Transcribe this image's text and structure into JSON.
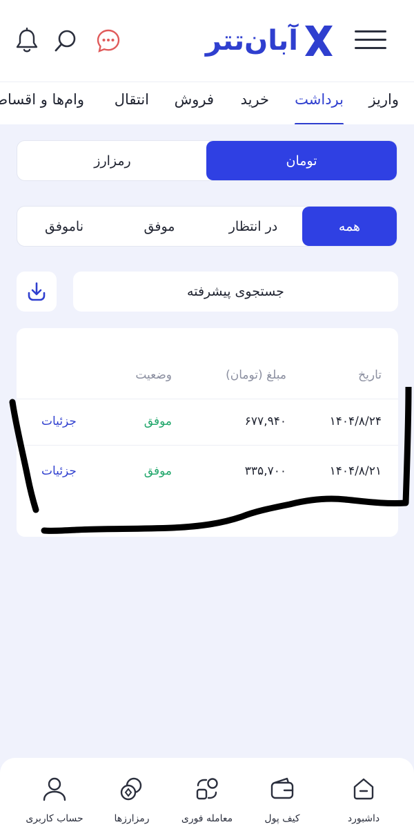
{
  "header": {
    "logo_text": "آبان‌تتر",
    "brand_color": "#2f3fcf",
    "icons": [
      "menu-icon",
      "chat-icon",
      "search-icon",
      "bell-icon"
    ]
  },
  "tabs": [
    {
      "label": "واریز",
      "active": false
    },
    {
      "label": "برداشت",
      "active": true
    },
    {
      "label": "خرید",
      "active": false
    },
    {
      "label": "فروش",
      "active": false
    },
    {
      "label": "انتقال",
      "active": false
    },
    {
      "label": "وام‌ها و اقساط",
      "active": false
    }
  ],
  "currency_filter": {
    "options": [
      "تومان",
      "رمزارز"
    ],
    "selected": "تومان"
  },
  "status_filter": {
    "options": [
      "همه",
      "در انتظار",
      "موفق",
      "ناموفق"
    ],
    "selected": "همه"
  },
  "search": {
    "advanced_label": "جستجوی پیشرفته"
  },
  "table": {
    "headers": {
      "date": "تاریخ",
      "amount": "مبلغ (تومان)",
      "status": "وضعیت"
    },
    "rows": [
      {
        "date": "۱۴۰۴/۸/۲۴",
        "amount": "۶۷۷,۹۴۰",
        "status": "موفق",
        "details": "جزئیات"
      },
      {
        "date": "۱۴۰۴/۸/۲۱",
        "amount": "۳۳۵,۷۰۰",
        "status": "موفق",
        "details": "جزئیات"
      }
    ]
  },
  "bottom_nav": [
    {
      "label": "داشبورد",
      "icon": "home-icon"
    },
    {
      "label": "کیف پول",
      "icon": "wallet-icon"
    },
    {
      "label": "معامله فوری",
      "icon": "exchange-icon"
    },
    {
      "label": "رمزارزها",
      "icon": "coins-icon"
    },
    {
      "label": "حساب کاربری",
      "icon": "user-icon"
    }
  ],
  "colors": {
    "accent": "#2f40e3",
    "success": "#1fa66a",
    "background": "#f0f2fc"
  }
}
